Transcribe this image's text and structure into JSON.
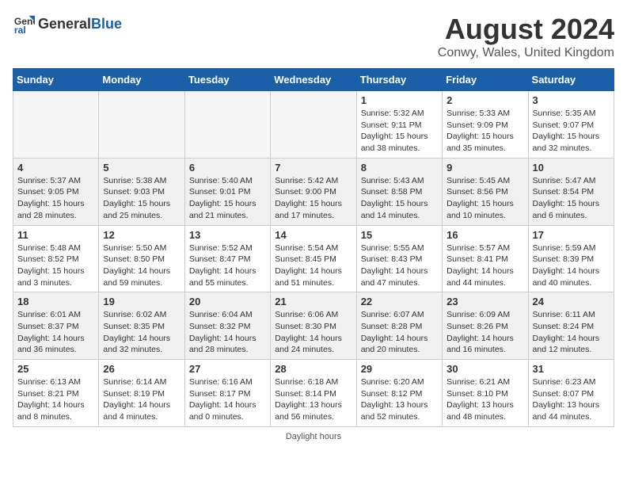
{
  "header": {
    "logo_general": "General",
    "logo_blue": "Blue",
    "month_title": "August 2024",
    "subtitle": "Conwy, Wales, United Kingdom"
  },
  "days_of_week": [
    "Sunday",
    "Monday",
    "Tuesday",
    "Wednesday",
    "Thursday",
    "Friday",
    "Saturday"
  ],
  "footer": "Daylight hours",
  "weeks": [
    [
      {
        "day": "",
        "info": ""
      },
      {
        "day": "",
        "info": ""
      },
      {
        "day": "",
        "info": ""
      },
      {
        "day": "",
        "info": ""
      },
      {
        "day": "1",
        "info": "Sunrise: 5:32 AM\nSunset: 9:11 PM\nDaylight: 15 hours\nand 38 minutes."
      },
      {
        "day": "2",
        "info": "Sunrise: 5:33 AM\nSunset: 9:09 PM\nDaylight: 15 hours\nand 35 minutes."
      },
      {
        "day": "3",
        "info": "Sunrise: 5:35 AM\nSunset: 9:07 PM\nDaylight: 15 hours\nand 32 minutes."
      }
    ],
    [
      {
        "day": "4",
        "info": "Sunrise: 5:37 AM\nSunset: 9:05 PM\nDaylight: 15 hours\nand 28 minutes."
      },
      {
        "day": "5",
        "info": "Sunrise: 5:38 AM\nSunset: 9:03 PM\nDaylight: 15 hours\nand 25 minutes."
      },
      {
        "day": "6",
        "info": "Sunrise: 5:40 AM\nSunset: 9:01 PM\nDaylight: 15 hours\nand 21 minutes."
      },
      {
        "day": "7",
        "info": "Sunrise: 5:42 AM\nSunset: 9:00 PM\nDaylight: 15 hours\nand 17 minutes."
      },
      {
        "day": "8",
        "info": "Sunrise: 5:43 AM\nSunset: 8:58 PM\nDaylight: 15 hours\nand 14 minutes."
      },
      {
        "day": "9",
        "info": "Sunrise: 5:45 AM\nSunset: 8:56 PM\nDaylight: 15 hours\nand 10 minutes."
      },
      {
        "day": "10",
        "info": "Sunrise: 5:47 AM\nSunset: 8:54 PM\nDaylight: 15 hours\nand 6 minutes."
      }
    ],
    [
      {
        "day": "11",
        "info": "Sunrise: 5:48 AM\nSunset: 8:52 PM\nDaylight: 15 hours\nand 3 minutes."
      },
      {
        "day": "12",
        "info": "Sunrise: 5:50 AM\nSunset: 8:50 PM\nDaylight: 14 hours\nand 59 minutes."
      },
      {
        "day": "13",
        "info": "Sunrise: 5:52 AM\nSunset: 8:47 PM\nDaylight: 14 hours\nand 55 minutes."
      },
      {
        "day": "14",
        "info": "Sunrise: 5:54 AM\nSunset: 8:45 PM\nDaylight: 14 hours\nand 51 minutes."
      },
      {
        "day": "15",
        "info": "Sunrise: 5:55 AM\nSunset: 8:43 PM\nDaylight: 14 hours\nand 47 minutes."
      },
      {
        "day": "16",
        "info": "Sunrise: 5:57 AM\nSunset: 8:41 PM\nDaylight: 14 hours\nand 44 minutes."
      },
      {
        "day": "17",
        "info": "Sunrise: 5:59 AM\nSunset: 8:39 PM\nDaylight: 14 hours\nand 40 minutes."
      }
    ],
    [
      {
        "day": "18",
        "info": "Sunrise: 6:01 AM\nSunset: 8:37 PM\nDaylight: 14 hours\nand 36 minutes."
      },
      {
        "day": "19",
        "info": "Sunrise: 6:02 AM\nSunset: 8:35 PM\nDaylight: 14 hours\nand 32 minutes."
      },
      {
        "day": "20",
        "info": "Sunrise: 6:04 AM\nSunset: 8:32 PM\nDaylight: 14 hours\nand 28 minutes."
      },
      {
        "day": "21",
        "info": "Sunrise: 6:06 AM\nSunset: 8:30 PM\nDaylight: 14 hours\nand 24 minutes."
      },
      {
        "day": "22",
        "info": "Sunrise: 6:07 AM\nSunset: 8:28 PM\nDaylight: 14 hours\nand 20 minutes."
      },
      {
        "day": "23",
        "info": "Sunrise: 6:09 AM\nSunset: 8:26 PM\nDaylight: 14 hours\nand 16 minutes."
      },
      {
        "day": "24",
        "info": "Sunrise: 6:11 AM\nSunset: 8:24 PM\nDaylight: 14 hours\nand 12 minutes."
      }
    ],
    [
      {
        "day": "25",
        "info": "Sunrise: 6:13 AM\nSunset: 8:21 PM\nDaylight: 14 hours\nand 8 minutes."
      },
      {
        "day": "26",
        "info": "Sunrise: 6:14 AM\nSunset: 8:19 PM\nDaylight: 14 hours\nand 4 minutes."
      },
      {
        "day": "27",
        "info": "Sunrise: 6:16 AM\nSunset: 8:17 PM\nDaylight: 14 hours\nand 0 minutes."
      },
      {
        "day": "28",
        "info": "Sunrise: 6:18 AM\nSunset: 8:14 PM\nDaylight: 13 hours\nand 56 minutes."
      },
      {
        "day": "29",
        "info": "Sunrise: 6:20 AM\nSunset: 8:12 PM\nDaylight: 13 hours\nand 52 minutes."
      },
      {
        "day": "30",
        "info": "Sunrise: 6:21 AM\nSunset: 8:10 PM\nDaylight: 13 hours\nand 48 minutes."
      },
      {
        "day": "31",
        "info": "Sunrise: 6:23 AM\nSunset: 8:07 PM\nDaylight: 13 hours\nand 44 minutes."
      }
    ]
  ]
}
